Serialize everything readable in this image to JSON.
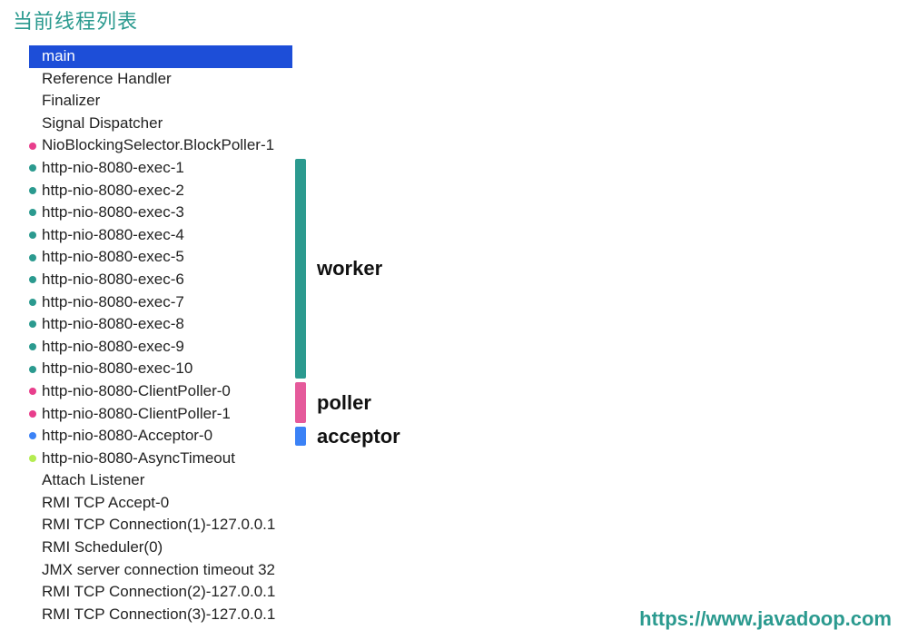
{
  "title": "当前线程列表",
  "watermark": "https://www.javadoop.com",
  "dot_colors": {
    "none": "",
    "pink": "#e83e8c",
    "teal": "#2b9a8f",
    "blue": "#3b82f6",
    "lime": "#b4ec51"
  },
  "threads": [
    {
      "name": "main",
      "dot": "none",
      "selected": true
    },
    {
      "name": "Reference Handler",
      "dot": "none",
      "selected": false
    },
    {
      "name": "Finalizer",
      "dot": "none",
      "selected": false
    },
    {
      "name": "Signal Dispatcher",
      "dot": "none",
      "selected": false
    },
    {
      "name": "NioBlockingSelector.BlockPoller-1",
      "dot": "pink",
      "selected": false
    },
    {
      "name": "http-nio-8080-exec-1",
      "dot": "teal",
      "selected": false
    },
    {
      "name": "http-nio-8080-exec-2",
      "dot": "teal",
      "selected": false
    },
    {
      "name": "http-nio-8080-exec-3",
      "dot": "teal",
      "selected": false
    },
    {
      "name": "http-nio-8080-exec-4",
      "dot": "teal",
      "selected": false
    },
    {
      "name": "http-nio-8080-exec-5",
      "dot": "teal",
      "selected": false
    },
    {
      "name": "http-nio-8080-exec-6",
      "dot": "teal",
      "selected": false
    },
    {
      "name": "http-nio-8080-exec-7",
      "dot": "teal",
      "selected": false
    },
    {
      "name": "http-nio-8080-exec-8",
      "dot": "teal",
      "selected": false
    },
    {
      "name": "http-nio-8080-exec-9",
      "dot": "teal",
      "selected": false
    },
    {
      "name": "http-nio-8080-exec-10",
      "dot": "teal",
      "selected": false
    },
    {
      "name": "http-nio-8080-ClientPoller-0",
      "dot": "pink",
      "selected": false
    },
    {
      "name": "http-nio-8080-ClientPoller-1",
      "dot": "pink",
      "selected": false
    },
    {
      "name": "http-nio-8080-Acceptor-0",
      "dot": "blue",
      "selected": false
    },
    {
      "name": "http-nio-8080-AsyncTimeout",
      "dot": "lime",
      "selected": false
    },
    {
      "name": "Attach Listener",
      "dot": "none",
      "selected": false
    },
    {
      "name": "RMI TCP Accept-0",
      "dot": "none",
      "selected": false
    },
    {
      "name": "RMI TCP Connection(1)-127.0.0.1",
      "dot": "none",
      "selected": false
    },
    {
      "name": "RMI Scheduler(0)",
      "dot": "none",
      "selected": false
    },
    {
      "name": "JMX server connection timeout 32",
      "dot": "none",
      "selected": false
    },
    {
      "name": "RMI TCP Connection(2)-127.0.0.1",
      "dot": "none",
      "selected": false
    },
    {
      "name": "RMI TCP Connection(3)-127.0.0.1",
      "dot": "none",
      "selected": false
    }
  ],
  "groups": [
    {
      "label": "worker",
      "color": "#2b9a8f",
      "from_index": 5,
      "to_index": 14
    },
    {
      "label": "poller",
      "color": "#e55a9b",
      "from_index": 15,
      "to_index": 16
    },
    {
      "label": "acceptor",
      "color": "#3b82f6",
      "from_index": 17,
      "to_index": 17
    }
  ]
}
